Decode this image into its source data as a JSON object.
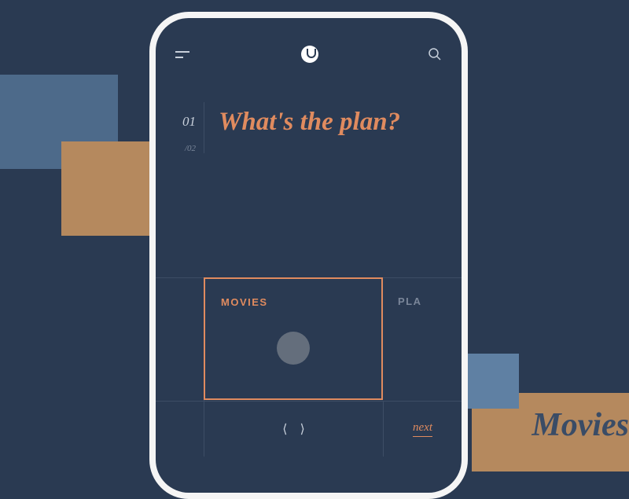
{
  "background": {
    "word": "Movies"
  },
  "steps": {
    "current": "01",
    "total": "/02"
  },
  "heading": "What's the plan?",
  "cards": [
    {
      "label": "MOVIES",
      "active": true
    },
    {
      "label": "PLA",
      "active": false
    }
  ],
  "footer": {
    "next": "next"
  }
}
